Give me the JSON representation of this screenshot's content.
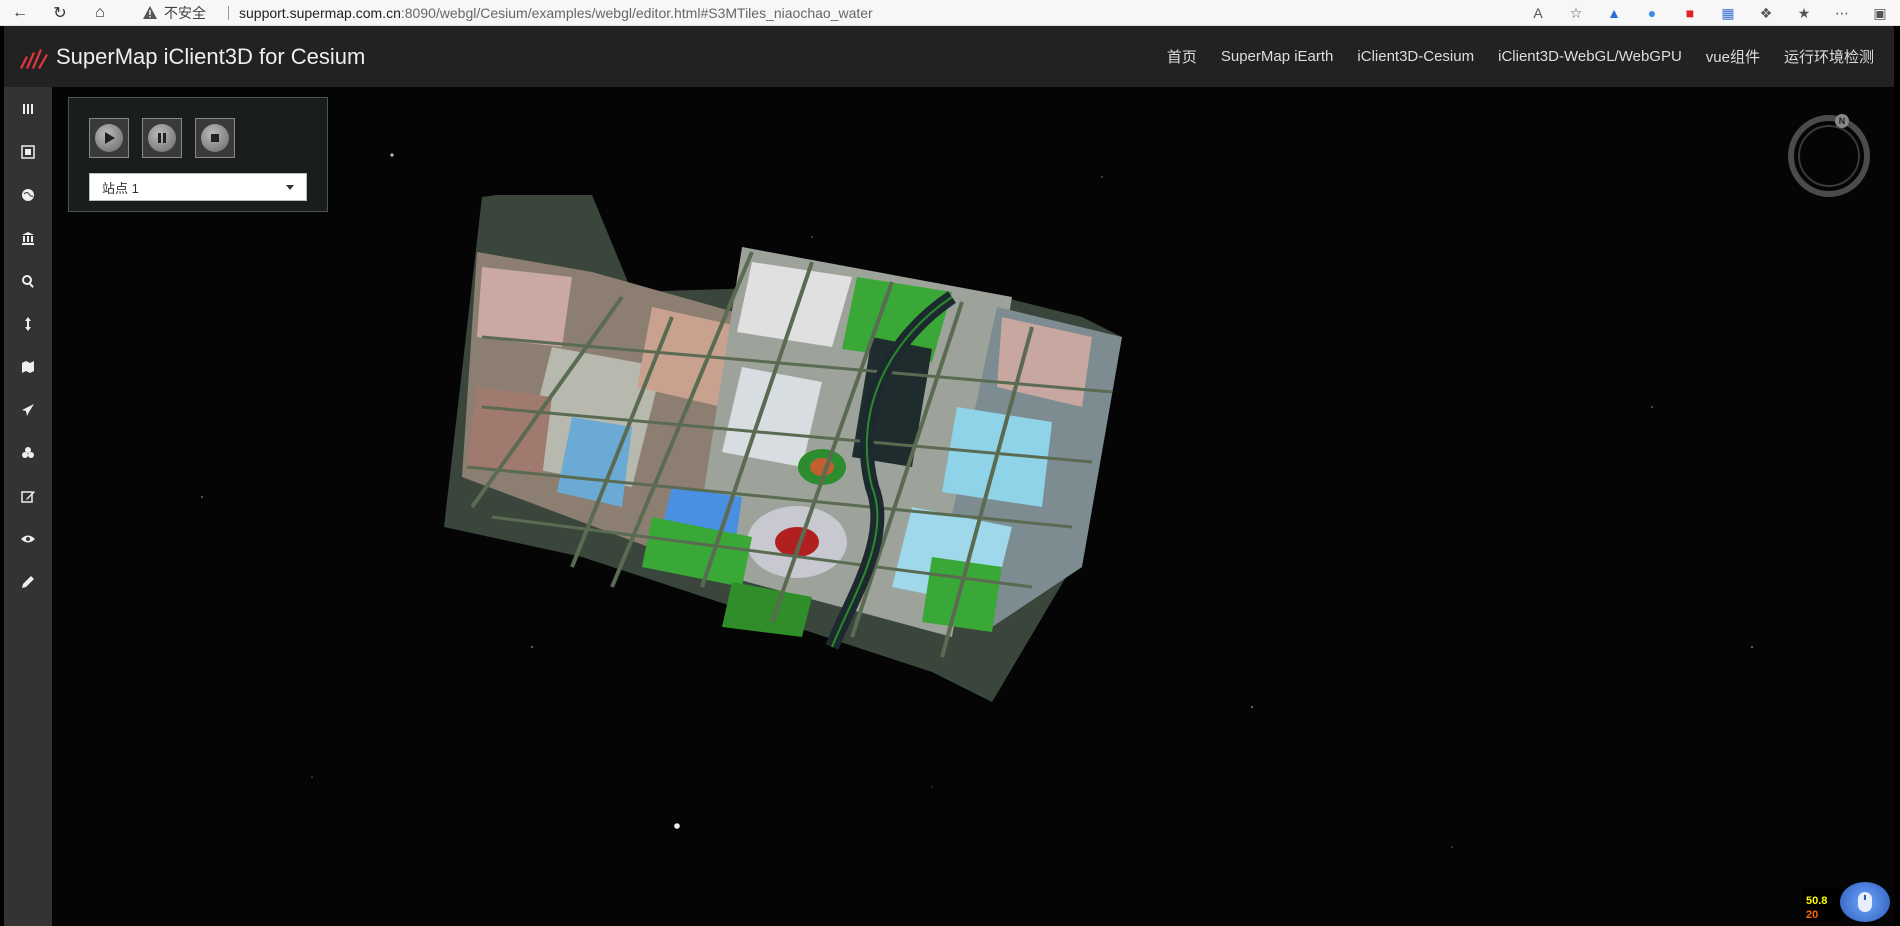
{
  "browser": {
    "security_label": "不安全",
    "url_host": "support.supermap.com.cn",
    "url_rest": ":8090/webgl/Cesium/examples/webgl/editor.html#S3MTiles_niaochao_water"
  },
  "header": {
    "title": "SuperMap iClient3D for Cesium",
    "nav": [
      "首页",
      "SuperMap iEarth",
      "iClient3D-Cesium",
      "iClient3D-WebGL/WebGPU",
      "vue组件",
      "运行环境检测"
    ]
  },
  "sidebar": {
    "items": [
      {
        "icon": "menu-bars-icon"
      },
      {
        "icon": "layers-icon"
      },
      {
        "icon": "globe-icon"
      },
      {
        "icon": "building-icon"
      },
      {
        "icon": "search-icon"
      },
      {
        "icon": "measure-icon"
      },
      {
        "icon": "map-icon"
      },
      {
        "icon": "fly-icon"
      },
      {
        "icon": "analysis-icon"
      },
      {
        "icon": "edit-icon"
      },
      {
        "icon": "view-icon"
      },
      {
        "icon": "draw-icon"
      }
    ]
  },
  "scene_panel": {
    "selected_station": "站点 1"
  },
  "status": {
    "fps": "50.8",
    "ms": "20"
  },
  "colors": {
    "header_bg": "#222222",
    "sidebar_bg": "#333333",
    "accent": "#e0373c"
  }
}
